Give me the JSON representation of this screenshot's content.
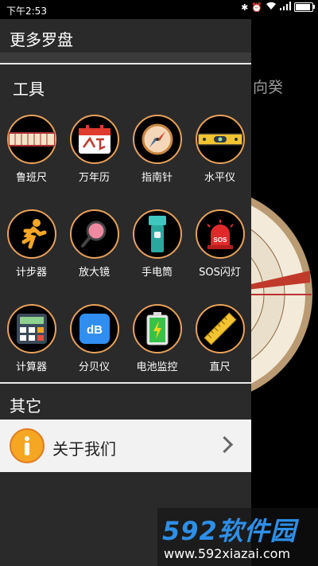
{
  "status_bar": {
    "time": "下午2:53"
  },
  "background": {
    "partial_text": "向癸"
  },
  "drawer": {
    "title": "更多罗盘",
    "tools_section": {
      "title": "工具",
      "items": [
        {
          "label": "鲁班尺",
          "icon": "ruler-wood-icon"
        },
        {
          "label": "万年历",
          "icon": "calendar-icon"
        },
        {
          "label": "指南针",
          "icon": "compass-icon"
        },
        {
          "label": "水平仪",
          "icon": "spirit-level-icon"
        },
        {
          "label": "计步器",
          "icon": "runner-icon"
        },
        {
          "label": "放大镜",
          "icon": "magnifier-icon"
        },
        {
          "label": "手电筒",
          "icon": "flashlight-icon"
        },
        {
          "label": "SOS闪灯",
          "icon": "sos-light-icon"
        },
        {
          "label": "计算器",
          "icon": "calculator-icon"
        },
        {
          "label": "分贝仪",
          "icon": "decibel-icon"
        },
        {
          "label": "电池监控",
          "icon": "battery-monitor-icon"
        },
        {
          "label": "直尺",
          "icon": "ruler-icon"
        }
      ]
    },
    "other_section": {
      "title": "其它",
      "about_label": "关于我们"
    }
  },
  "watermark": {
    "brand": "592软件园",
    "url": "www.592xiazai.com"
  },
  "colors": {
    "drawer_bg": "#2a2a2a",
    "ring": "#e9a15a",
    "about_bg": "#f2f2f2"
  }
}
